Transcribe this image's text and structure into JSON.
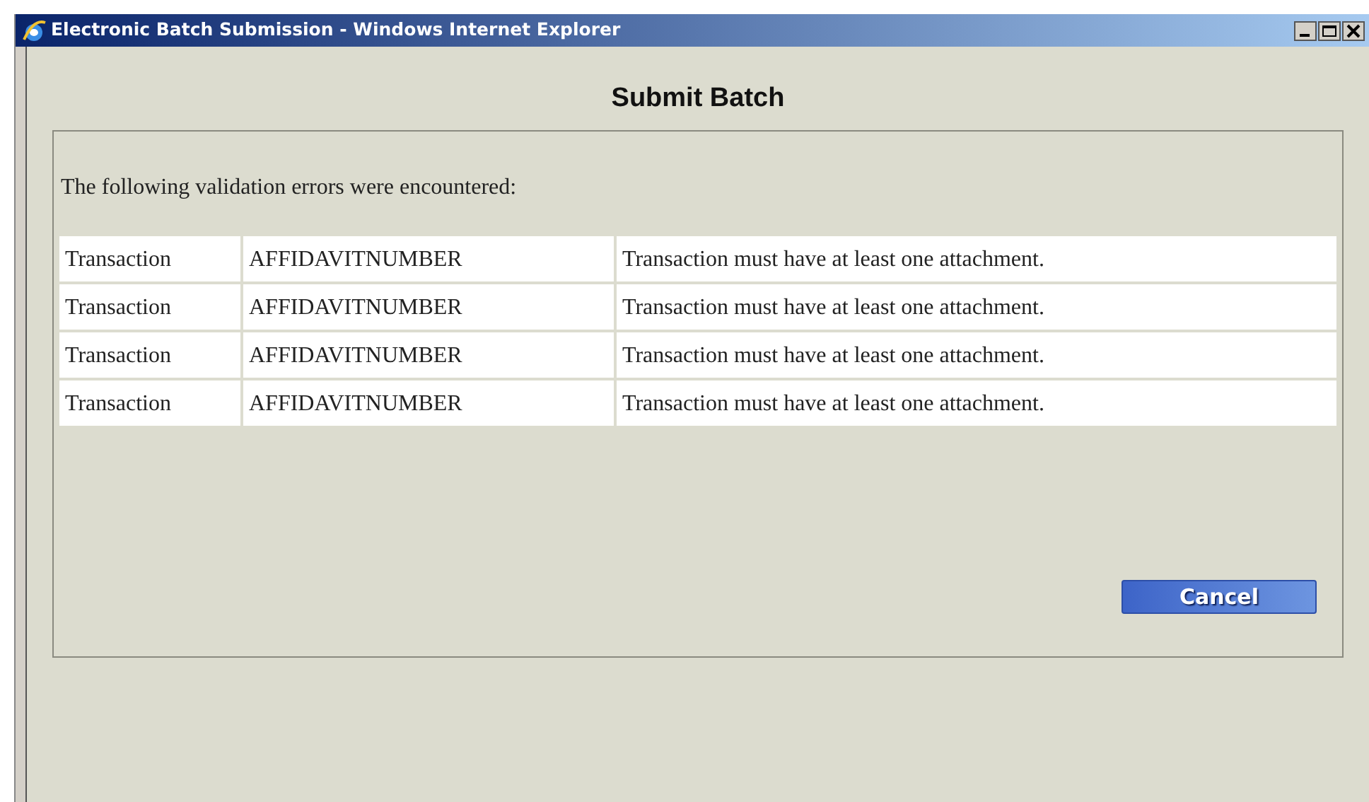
{
  "window": {
    "title": "Electronic Batch Submission - Windows Internet Explorer"
  },
  "page": {
    "heading": "Submit Batch",
    "message": "The following validation errors were encountered:"
  },
  "errors": [
    {
      "level": "Transaction",
      "field": "AFFIDAVITNUMBER",
      "description": "Transaction must have at least one attachment."
    },
    {
      "level": "Transaction",
      "field": "AFFIDAVITNUMBER",
      "description": "Transaction must have at least one attachment."
    },
    {
      "level": "Transaction",
      "field": "AFFIDAVITNUMBER",
      "description": "Transaction must have at least one attachment."
    },
    {
      "level": "Transaction",
      "field": "AFFIDAVITNUMBER",
      "description": "Transaction must have at least one attachment."
    }
  ],
  "buttons": [
    "Cancel"
  ]
}
